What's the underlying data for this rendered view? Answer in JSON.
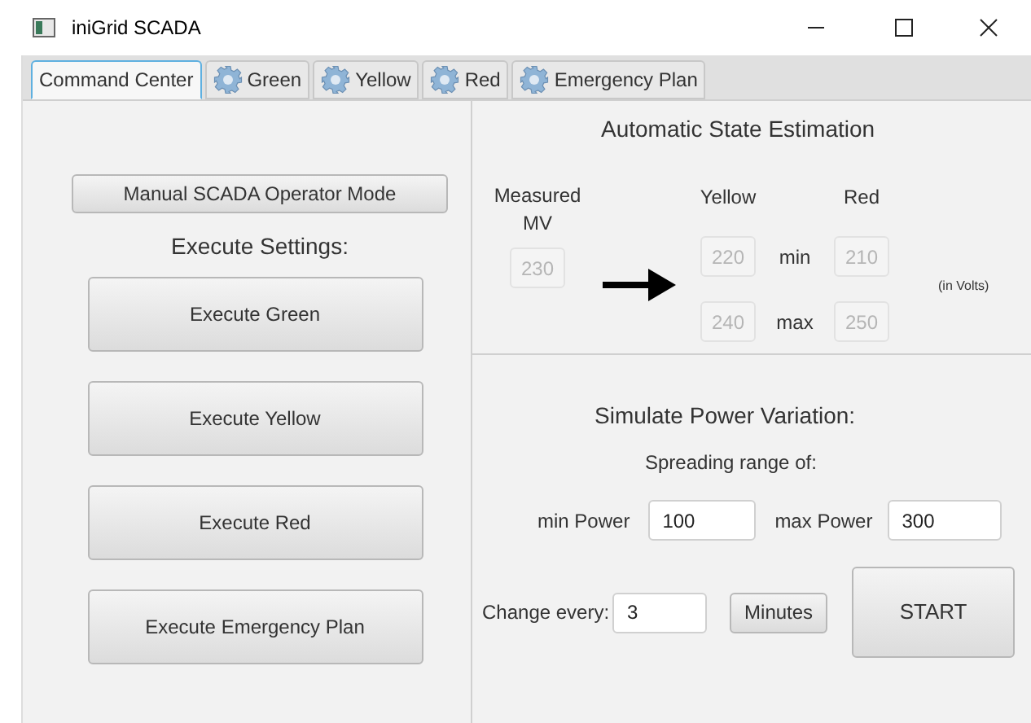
{
  "window": {
    "title": "iniGrid SCADA"
  },
  "tabs": [
    {
      "label": "Command Center",
      "selected": true,
      "icon": false
    },
    {
      "label": "Green",
      "selected": false,
      "icon": true
    },
    {
      "label": "Yellow",
      "selected": false,
      "icon": true
    },
    {
      "label": "Red",
      "selected": false,
      "icon": true
    },
    {
      "label": "Emergency Plan",
      "selected": false,
      "icon": true
    }
  ],
  "left": {
    "mode_button": "Manual  SCADA Operator Mode",
    "execute_label": "Execute Settings:",
    "execute_buttons": [
      "Execute Green",
      "Execute Yellow",
      "Execute Red",
      "Execute Emergency Plan"
    ]
  },
  "estimation": {
    "title": "Automatic State Estimation",
    "measured_label": "Measured MV",
    "measured": {
      "value": "230",
      "disabled": true
    },
    "yellow_label": "Yellow",
    "red_label": "Red",
    "min_label": "min",
    "max_label": "max",
    "yellow_min": {
      "value": "220",
      "disabled": true
    },
    "red_min": {
      "value": "210",
      "disabled": true
    },
    "yellow_max": {
      "value": "240",
      "disabled": true
    },
    "red_max": {
      "value": "250",
      "disabled": true
    },
    "unit": "(in Volts)"
  },
  "simulation": {
    "title": "Simulate Power Variation:",
    "subtitle": "Spreading range of:",
    "min_label": "min Power",
    "min_power": {
      "value": "100",
      "disabled": false
    },
    "max_label": "max Power",
    "max_power": {
      "value": "300",
      "disabled": false
    },
    "change_label": "Change every:",
    "change": {
      "value": "3",
      "disabled": false
    },
    "unit_button": "Minutes",
    "start_button": "START"
  }
}
